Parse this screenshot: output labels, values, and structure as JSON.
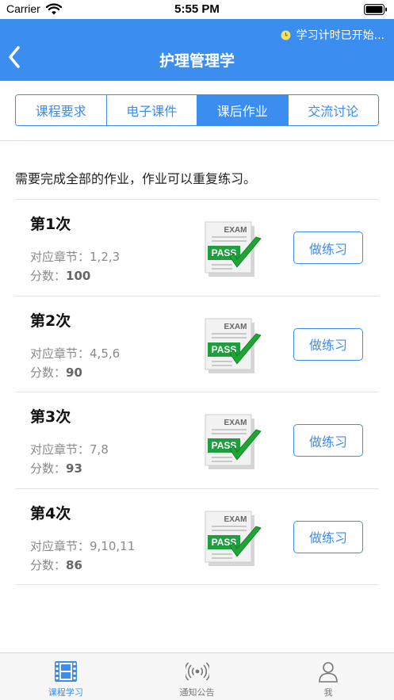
{
  "status_bar": {
    "carrier": "Carrier",
    "time": "5:55 PM"
  },
  "nav": {
    "title": "护理管理学",
    "timer_text": "学习计时已开始..."
  },
  "tabs": [
    {
      "label": "课程要求",
      "active": false
    },
    {
      "label": "电子课件",
      "active": false
    },
    {
      "label": "课后作业",
      "active": true
    },
    {
      "label": "交流讨论",
      "active": false
    }
  ],
  "intro": "需要完成全部的作业，作业可以重复练习。",
  "labels": {
    "chapter": "对应章节：",
    "score": "分数：",
    "practice": "做练习"
  },
  "badge": {
    "top_text": "EXAM",
    "stamp_text": "PASS",
    "colors": {
      "green": "#1e9e3e",
      "check": "#1fa535"
    }
  },
  "assignments": [
    {
      "title": "第1次",
      "chapters": "1,2,3",
      "score": "100"
    },
    {
      "title": "第2次",
      "chapters": "4,5,6",
      "score": "90"
    },
    {
      "title": "第3次",
      "chapters": "7,8",
      "score": "93"
    },
    {
      "title": "第4次",
      "chapters": "9,10,11",
      "score": "86"
    }
  ],
  "tabbar": [
    {
      "label": "课程学习",
      "icon": "film-icon",
      "active": true
    },
    {
      "label": "通知公告",
      "icon": "broadcast-icon",
      "active": false
    },
    {
      "label": "我",
      "icon": "person-icon",
      "active": false
    }
  ],
  "colors": {
    "primary": "#3b8df0",
    "separator": "#e3e3e3"
  }
}
